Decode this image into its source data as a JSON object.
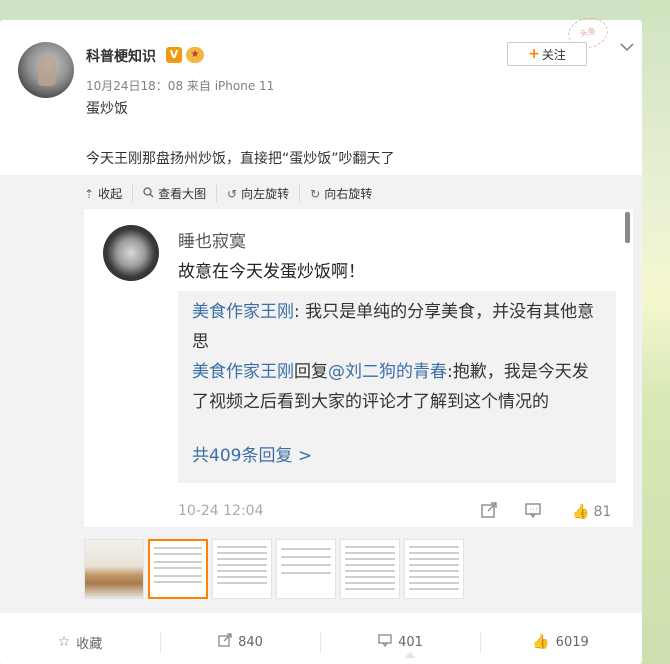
{
  "post": {
    "username": "科普梗知识",
    "badge_v": "V",
    "meta": "10月24日18：08 来自 iPhone 11",
    "follow_label": "关注",
    "text_title": "蛋炒饭",
    "text_body": "今天王刚那盘扬州炒饭，直接把“蛋炒饭”吵翻天了"
  },
  "media_bar": {
    "collapse": "收起",
    "view_large": "查看大图",
    "rotate_left": "向左旋转",
    "rotate_right": "向右旋转"
  },
  "screenshot": {
    "commenter": "睡也寂寞",
    "comment": "故意在今天发蛋炒饭啊！",
    "replies": [
      {
        "name": "美食作家王刚",
        "sep": ":",
        "text": "我只是单纯的分享美食，并没有其他意思"
      },
      {
        "name": "美食作家王刚",
        "mid": "回复",
        "mention": "@刘二狗的青春",
        "text": ":抱歉，我是今天发了视频之后看到大家的评论才了解到这个情况的"
      }
    ],
    "more_replies": "共409条回复 >",
    "time": "10-24 12:04",
    "likes": "81"
  },
  "actions": {
    "favorite": "收藏",
    "repost": "840",
    "comment": "401",
    "like": "6019"
  }
}
